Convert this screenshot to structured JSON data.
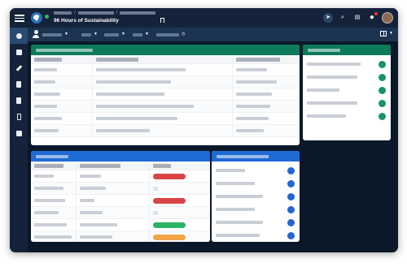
{
  "header": {
    "title": "96 Hours of Sustainability"
  },
  "colors": {
    "brand_green": "#0d7a5a",
    "brand_blue": "#1e6bd6",
    "status_red": "#d94444",
    "status_green": "#2bb364",
    "status_orange": "#f1a649"
  },
  "icons": {
    "menu": "hamburger-icon",
    "logo": "app-logo-icon",
    "bookmark": "bookmark-icon",
    "navigate": "navigate-icon",
    "search": "search-icon",
    "chat": "chat-icon",
    "bell": "bell-icon",
    "layout": "layout-grid-icon"
  },
  "sidebar": {
    "items": [
      {
        "name": "users",
        "active": true
      },
      {
        "name": "tasks"
      },
      {
        "name": "edit"
      },
      {
        "name": "documents"
      },
      {
        "name": "reports"
      },
      {
        "name": "device"
      },
      {
        "name": "dashboard"
      }
    ]
  },
  "left_table": {
    "status_pills": [
      "red",
      "none",
      "red",
      "none",
      "green",
      "orange"
    ]
  }
}
